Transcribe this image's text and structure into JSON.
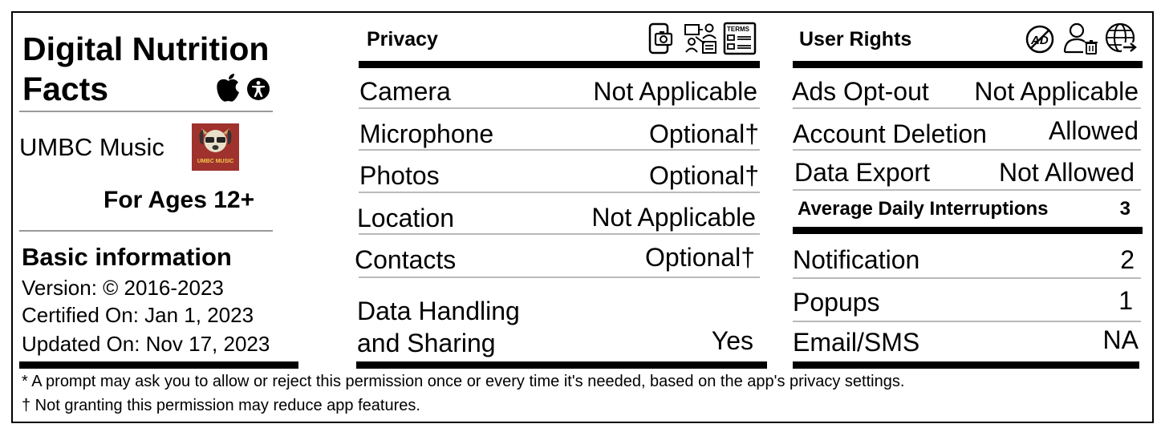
{
  "label": {
    "title_line1": "Digital Nutrition",
    "title_line2": "Facts",
    "apple_icon": "apple-logo-icon",
    "accessibility_icon": "accessibility-icon"
  },
  "app": {
    "name": "UMBC Music",
    "icon_text": "UMBC MUSIC",
    "icon_bg": "#a0322d",
    "ages": "For Ages 12+"
  },
  "basic": {
    "heading": "Basic information",
    "version": "Version: © 2016-2023",
    "certified": "Certified On: Jan 1, 2023",
    "updated": "Updated On: Nov 17, 2023"
  },
  "privacy": {
    "heading": "Privacy",
    "icons": [
      "phone-camera-icon",
      "data-sharing-icon",
      "terms-document-icon"
    ],
    "terms_icon_text": "TERMS",
    "rows": [
      {
        "label": "Camera",
        "value": "Not Applicable"
      },
      {
        "label": "Microphone",
        "value": "Optional†"
      },
      {
        "label": "Photos",
        "value": "Optional†"
      },
      {
        "label": "Location",
        "value": "Not Applicable"
      },
      {
        "label": "Contacts",
        "value": "Optional†"
      }
    ],
    "data_handling_line1": "Data Handling",
    "data_handling_line2": "and Sharing",
    "data_handling_value": "Yes"
  },
  "rights": {
    "heading": "User Rights",
    "icons": [
      "no-ads-icon",
      "delete-account-icon",
      "export-globe-icon"
    ],
    "no_ads_icon_text": "AD",
    "rows": [
      {
        "label": "Ads Opt-out",
        "value": "Not Applicable"
      },
      {
        "label": "Account Deletion",
        "value": "Allowed"
      },
      {
        "label": "Data Export",
        "value": "Not Allowed"
      }
    ]
  },
  "interruptions": {
    "heading": "Average Daily Interruptions",
    "total": "3",
    "rows": [
      {
        "label": "Notification",
        "value": "2"
      },
      {
        "label": "Popups",
        "value": "1"
      },
      {
        "label": "Email/SMS",
        "value": "NA"
      }
    ]
  },
  "footnotes": {
    "asterisk": "* A prompt may ask you to allow or reject this permission once or every time it's needed, based on the app's privacy settings.",
    "dagger": "† Not granting this permission may reduce app features."
  }
}
